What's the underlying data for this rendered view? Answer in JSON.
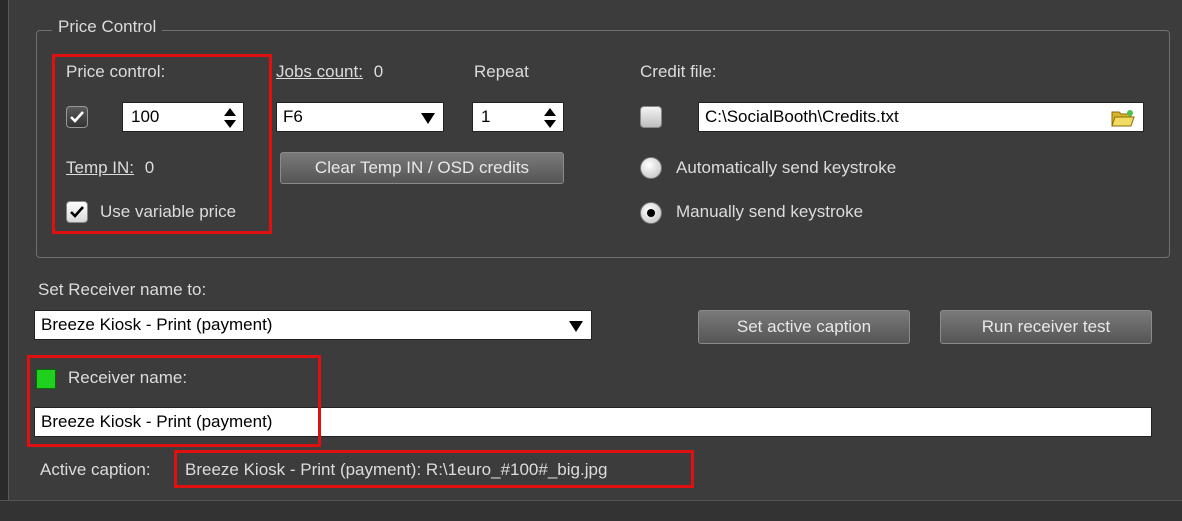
{
  "price_control": {
    "group_title": "Price Control",
    "price_control_label": "Price control:",
    "price_value": "100",
    "jobs_count_label": "Jobs count:",
    "jobs_count_value": "0",
    "jobs_key_value": "F6",
    "repeat_label": "Repeat",
    "repeat_value": "1",
    "credit_file_label": "Credit file:",
    "credit_file_path": "C:\\SocialBooth\\Credits.txt",
    "temp_in_label": "Temp IN:",
    "temp_in_value": "0",
    "clear_button_label": "Clear Temp IN / OSD credits",
    "auto_keystroke_label": "Automatically send keystroke",
    "manual_keystroke_label": "Manually send keystroke",
    "use_variable_price_label": "Use variable price",
    "price_checkbox_checked": true,
    "use_variable_price_checked": true,
    "credit_file_checked": false,
    "keystroke_mode_selected": "manual"
  },
  "receiver": {
    "set_name_label": "Set Receiver name to:",
    "selected_receiver": "Breeze Kiosk - Print (payment)",
    "set_active_caption_button": "Set active caption",
    "run_receiver_test_button": "Run receiver test",
    "receiver_name_label": "Receiver name:",
    "receiver_name_value": "Breeze Kiosk - Print (payment)",
    "status_color": "#1fd01f",
    "active_caption_label": "Active caption:",
    "active_caption_value": "Breeze Kiosk - Print (payment): R:\\1euro_#100#_big.jpg"
  },
  "colors": {
    "background": "#3c3c3c",
    "highlight": "#e01010"
  }
}
